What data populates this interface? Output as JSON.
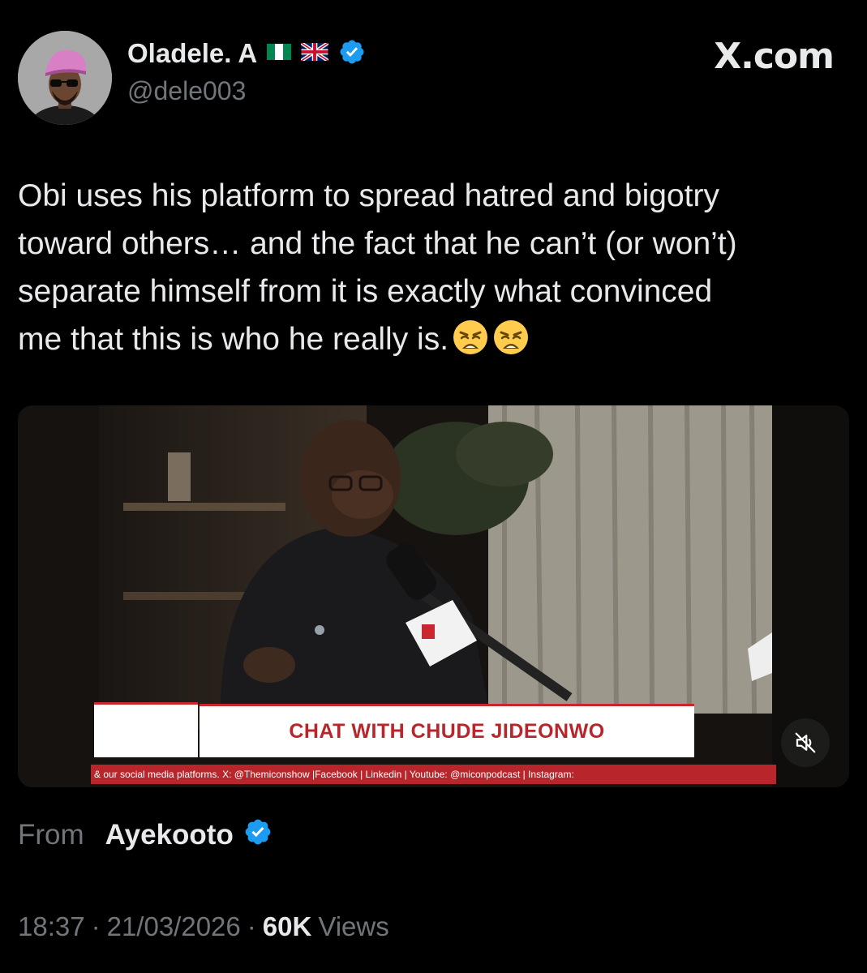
{
  "author": {
    "display_name": "Oladele. A",
    "handle": "@dele003",
    "flags": [
      "nigeria-flag-icon",
      "uk-flag-icon"
    ],
    "verified": true
  },
  "brand": "X.com",
  "tweet": {
    "text": "Obi uses his platform to spread hatred and bigotry\ntoward others… and the fact that he can’t (or won’t)\nseparate himself from it is exactly what convinced\nme that this is who he really is.",
    "emojis": [
      "weary-face-icon",
      "weary-face-icon"
    ]
  },
  "media": {
    "lower_third_title": "CHAT WITH CHUDE JIDEONWO",
    "ticker_text": "& our social media platforms. X: @Themiconshow |Facebook | Linkedin | Youtube: @miconpodcast | Instagram:",
    "mute_icon": "muted-speaker-icon"
  },
  "attribution": {
    "from_label": "From",
    "account": "Ayekooto",
    "verified": true
  },
  "meta": {
    "time": "18:37",
    "date": "21/03/2026",
    "views_count": "60K",
    "views_label": "Views",
    "separator": "·"
  },
  "colors": {
    "background": "#000000",
    "text": "#e7e9ea",
    "secondary_text": "#71767b",
    "verified_blue": "#1d9bf0",
    "lower_third_red": "#b8262b"
  }
}
